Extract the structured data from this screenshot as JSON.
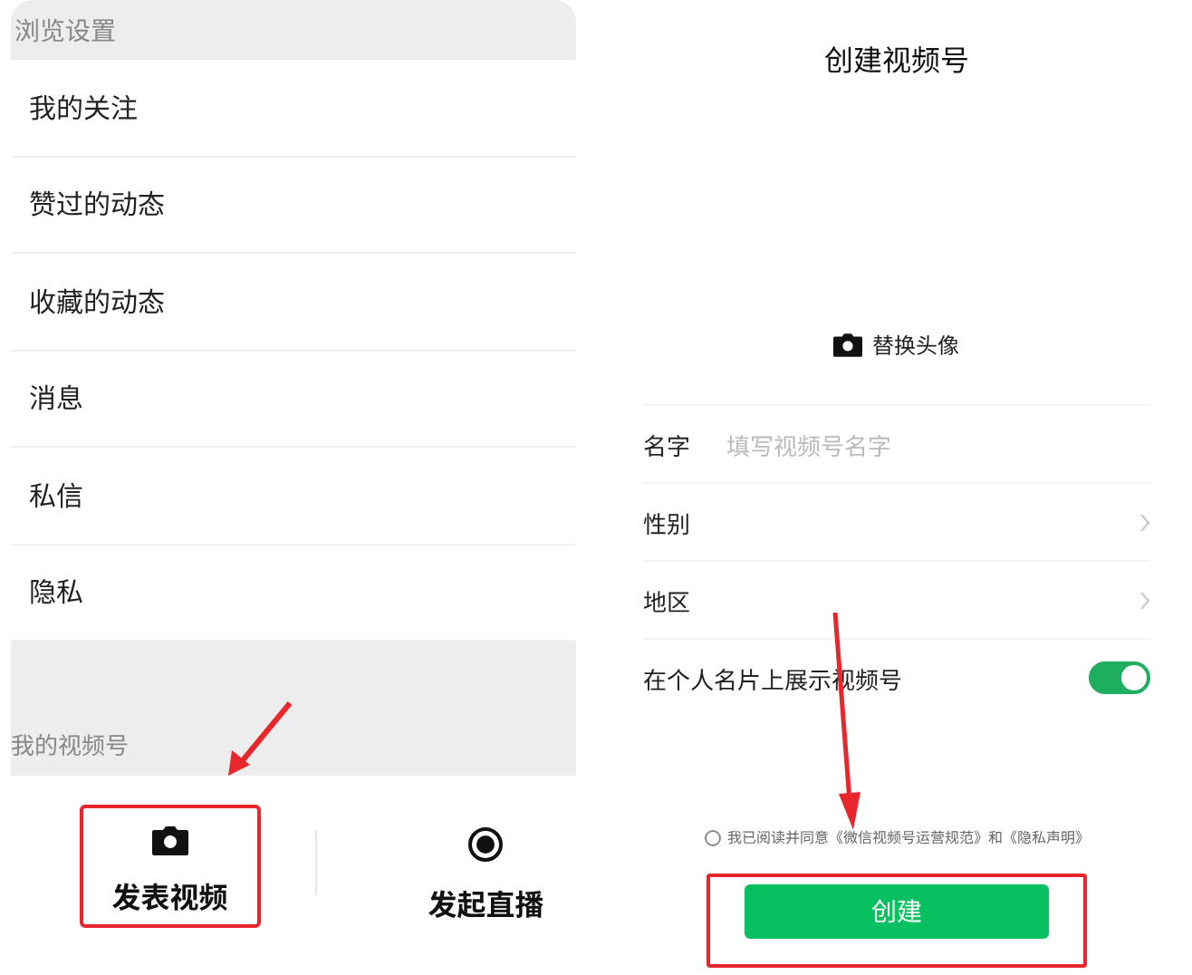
{
  "browse_settings": {
    "header": "浏览设置",
    "items": [
      {
        "label": "我的关注"
      },
      {
        "label": "赞过的动态"
      },
      {
        "label": "收藏的动态"
      },
      {
        "label": "消息"
      },
      {
        "label": "私信"
      },
      {
        "label": "隐私"
      }
    ]
  },
  "channel_section": {
    "header": "我的视频号",
    "actions": [
      {
        "kind": "camera",
        "label": "发表视频",
        "highlighted": true
      },
      {
        "kind": "record",
        "label": "发起直播",
        "highlighted": false
      }
    ]
  },
  "create_form": {
    "title": "创建视频号",
    "avatar_button": "替换头像",
    "fields": [
      {
        "kind": "input",
        "label": "名字",
        "placeholder": "填写视频号名字"
      },
      {
        "kind": "select",
        "label": "性别"
      },
      {
        "kind": "select",
        "label": "地区"
      },
      {
        "kind": "toggle",
        "label": "在个人名片上展示视频号",
        "on": true
      }
    ],
    "agreement": {
      "text": "我已阅读并同意《微信视频号运营规范》和《隐私声明》",
      "checked": false
    },
    "submit": {
      "label": "创建",
      "highlighted": true
    }
  }
}
